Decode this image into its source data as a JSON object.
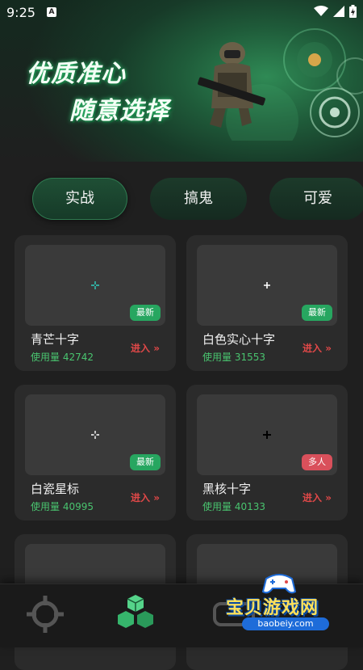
{
  "status_bar": {
    "time": "9:25",
    "notification_icon": "A"
  },
  "hero": {
    "line1": "优质准心",
    "line2": "随意选择"
  },
  "tabs": [
    {
      "label": "实战",
      "active": true
    },
    {
      "label": "搞鬼",
      "active": false
    },
    {
      "label": "可爱",
      "active": false
    }
  ],
  "cards": [
    {
      "name": "青芒十字",
      "usage": "使用量 42742",
      "badge": "最新",
      "badge_type": "new",
      "enter": "进入",
      "crosshair_color": "#2fd0c0"
    },
    {
      "name": "白色实心十字",
      "usage": "使用量 31553",
      "badge": "最新",
      "badge_type": "new",
      "enter": "进入",
      "crosshair_color": "#ffffff"
    },
    {
      "name": "白瓷星标",
      "usage": "使用量 40995",
      "badge": "最新",
      "badge_type": "new",
      "enter": "进入",
      "crosshair_color": "#ffffff"
    },
    {
      "name": "黑核十字",
      "usage": "使用量 40133",
      "badge": "多人",
      "badge_type": "multi",
      "enter": "进入",
      "crosshair_color": "#000000"
    }
  ],
  "bottom_nav": [
    {
      "icon": "crosshair-icon",
      "active": false
    },
    {
      "icon": "cubes-icon",
      "active": true
    },
    {
      "icon": "settings-icon",
      "active": false
    }
  ],
  "watermark": {
    "main": "宝贝游戏网",
    "url": "baobeiy.com"
  },
  "colors": {
    "accent_green": "#27a660",
    "usage_green": "#49c46f",
    "enter_red": "#e04848",
    "badge_multi": "#d9505b"
  }
}
